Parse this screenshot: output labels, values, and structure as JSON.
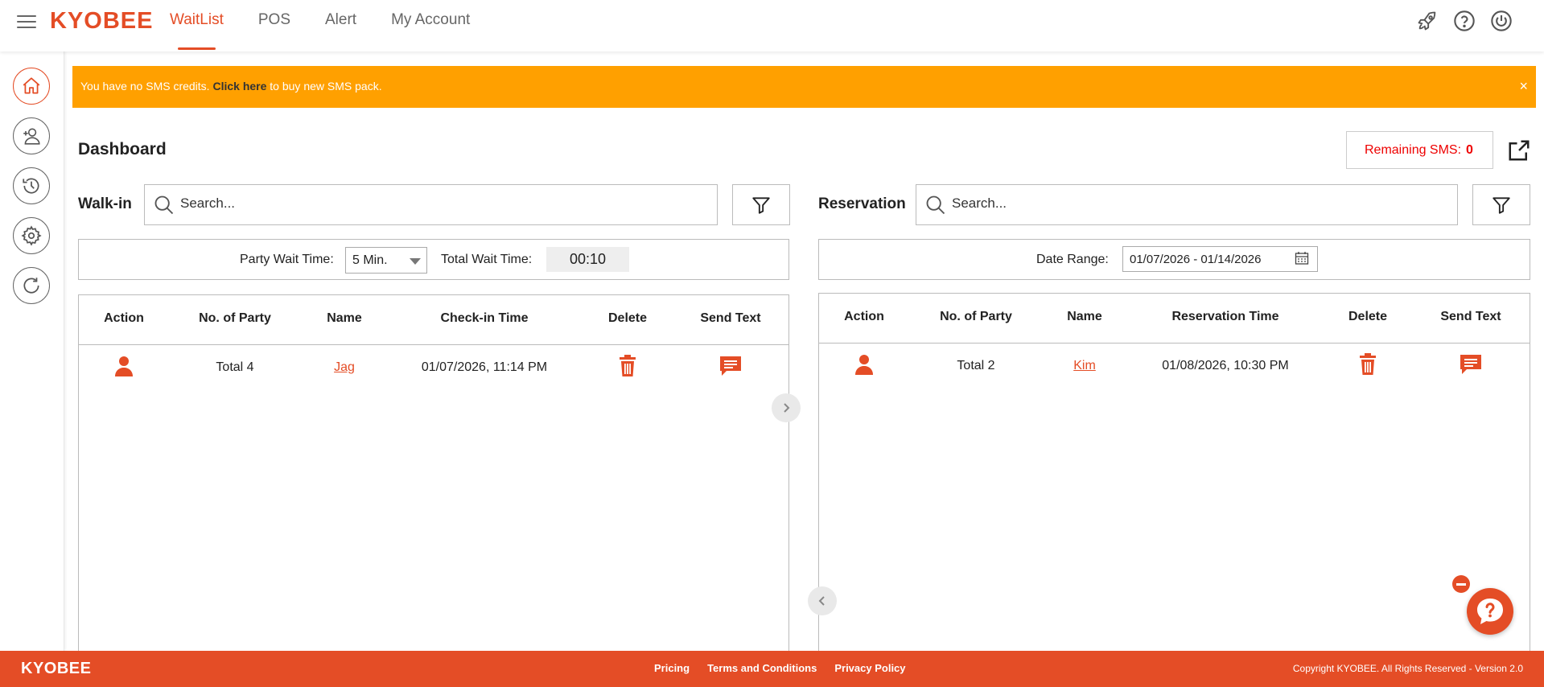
{
  "app": {
    "logo": "KYOBEE",
    "nav": [
      "WaitList",
      "POS",
      "Alert",
      "My Account"
    ],
    "active_nav": "WaitList"
  },
  "banner": {
    "text_before": "You have no SMS credits. ",
    "link": "Click here",
    "text_after": " to buy new SMS pack.",
    "close": "×",
    "color": "#ffa000"
  },
  "dashboard": {
    "title": "Dashboard",
    "remaining_label": "Remaining SMS:",
    "remaining_value": "0"
  },
  "walkin": {
    "label": "Walk-in",
    "search_placeholder": "Search...",
    "party_wait_label": "Party Wait Time:",
    "party_wait_value": "5 Min.",
    "total_wait_label": "Total Wait Time:",
    "total_wait_value": "00:10",
    "headers": [
      "Action",
      "No. of Party",
      "Name",
      "Check-in Time",
      "Delete",
      "Send Text"
    ],
    "rows": [
      {
        "party": "Total 4",
        "name": "Jag",
        "time": "01/07/2026, 11:14 PM"
      }
    ]
  },
  "reservation": {
    "label": "Reservation",
    "search_placeholder": "Search...",
    "date_range_label": "Date Range:",
    "date_range_value": "01/07/2026 - 01/14/2026",
    "headers": [
      "Action",
      "No. of Party",
      "Name",
      "Reservation Time",
      "Delete",
      "Send Text"
    ],
    "rows": [
      {
        "party": "Total 2",
        "name": "Kim",
        "time": "01/08/2026, 10:30 PM"
      }
    ]
  },
  "footer": {
    "logo": "KYOBEE",
    "links": [
      "Pricing",
      "Terms and Conditions",
      "Privacy Policy"
    ],
    "copyright": "Copyright KYOBEE. All Rights Reserved - Version 2.0"
  },
  "colors": {
    "accent": "#e44d26",
    "banner": "#ffa000"
  },
  "icons": {
    "top": [
      "rocket-icon",
      "help-icon",
      "power-icon"
    ],
    "sidebar": [
      "home-icon",
      "add-user-icon",
      "history-icon",
      "settings-icon",
      "refresh-icon"
    ]
  }
}
